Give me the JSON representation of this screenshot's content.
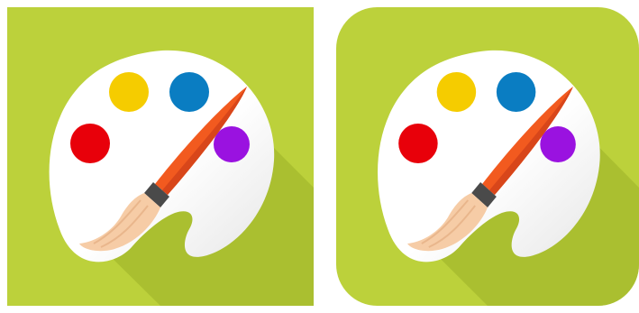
{
  "icons": [
    {
      "variant": "square",
      "subject": "paint-palette-with-brush",
      "colors": {
        "background": "#BCD13B",
        "long_shadow": "#A7BC2F",
        "palette": "#FFFFFF",
        "palette_shade": "#E6E6E6",
        "paint_red": "#E8000A",
        "paint_yellow": "#F5CC00",
        "paint_blue": "#0A7DC2",
        "paint_purple": "#9A12E0",
        "brush_handle": "#F25A1F",
        "brush_ferrule": "#4A4A4A",
        "brush_bristles": "#F6CCA6"
      }
    },
    {
      "variant": "rounded-square",
      "subject": "paint-palette-with-brush",
      "colors": {
        "background": "#BCD13B",
        "long_shadow": "#A7BC2F",
        "palette": "#FFFFFF",
        "palette_shade": "#E6E6E6",
        "paint_red": "#E8000A",
        "paint_yellow": "#F5CC00",
        "paint_blue": "#0A7DC2",
        "paint_purple": "#9A12E0",
        "brush_handle": "#F25A1F",
        "brush_ferrule": "#4A4A4A",
        "brush_bristles": "#F6CCA6"
      }
    }
  ]
}
